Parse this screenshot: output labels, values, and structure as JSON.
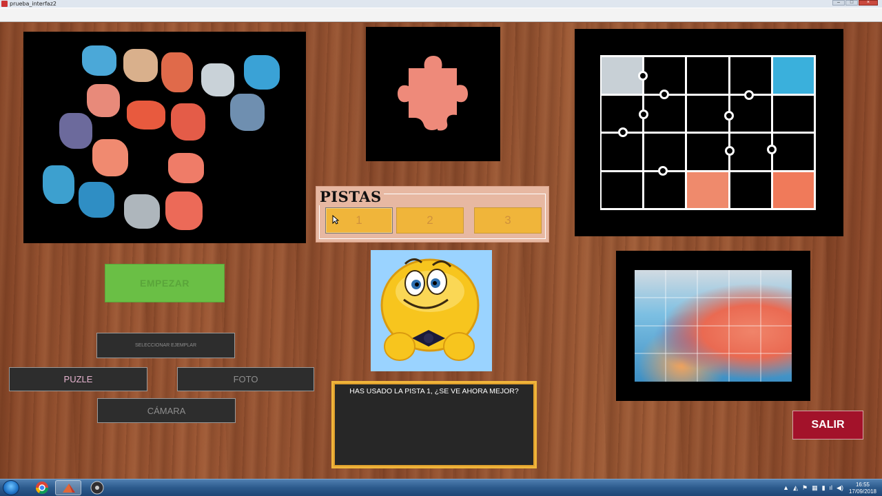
{
  "window": {
    "title": "prueba_interfaz2"
  },
  "pistas": {
    "title": "PISTAS",
    "buttons": [
      {
        "label": "1"
      },
      {
        "label": "2"
      },
      {
        "label": "3"
      }
    ]
  },
  "controls": {
    "empezar_label": "EMPEZAR",
    "seleccionar_label": "SELECCIONAR EJEMPLAR",
    "puzle_label": "PUZLE",
    "foto_label": "FOTO",
    "camara_label": "CÁMARA",
    "salir_label": "SALIR"
  },
  "message": {
    "text": "HAS USADO LA PISTA 1, ¿SE VE AHORA MEJOR?"
  },
  "taskbar": {
    "time": "16:55",
    "date": "17/09/2018"
  },
  "colors": {
    "accent_yellow": "#f0b53a",
    "start_green": "#6abf45",
    "exit_red": "#a3122a",
    "panel_dark": "#272727"
  }
}
